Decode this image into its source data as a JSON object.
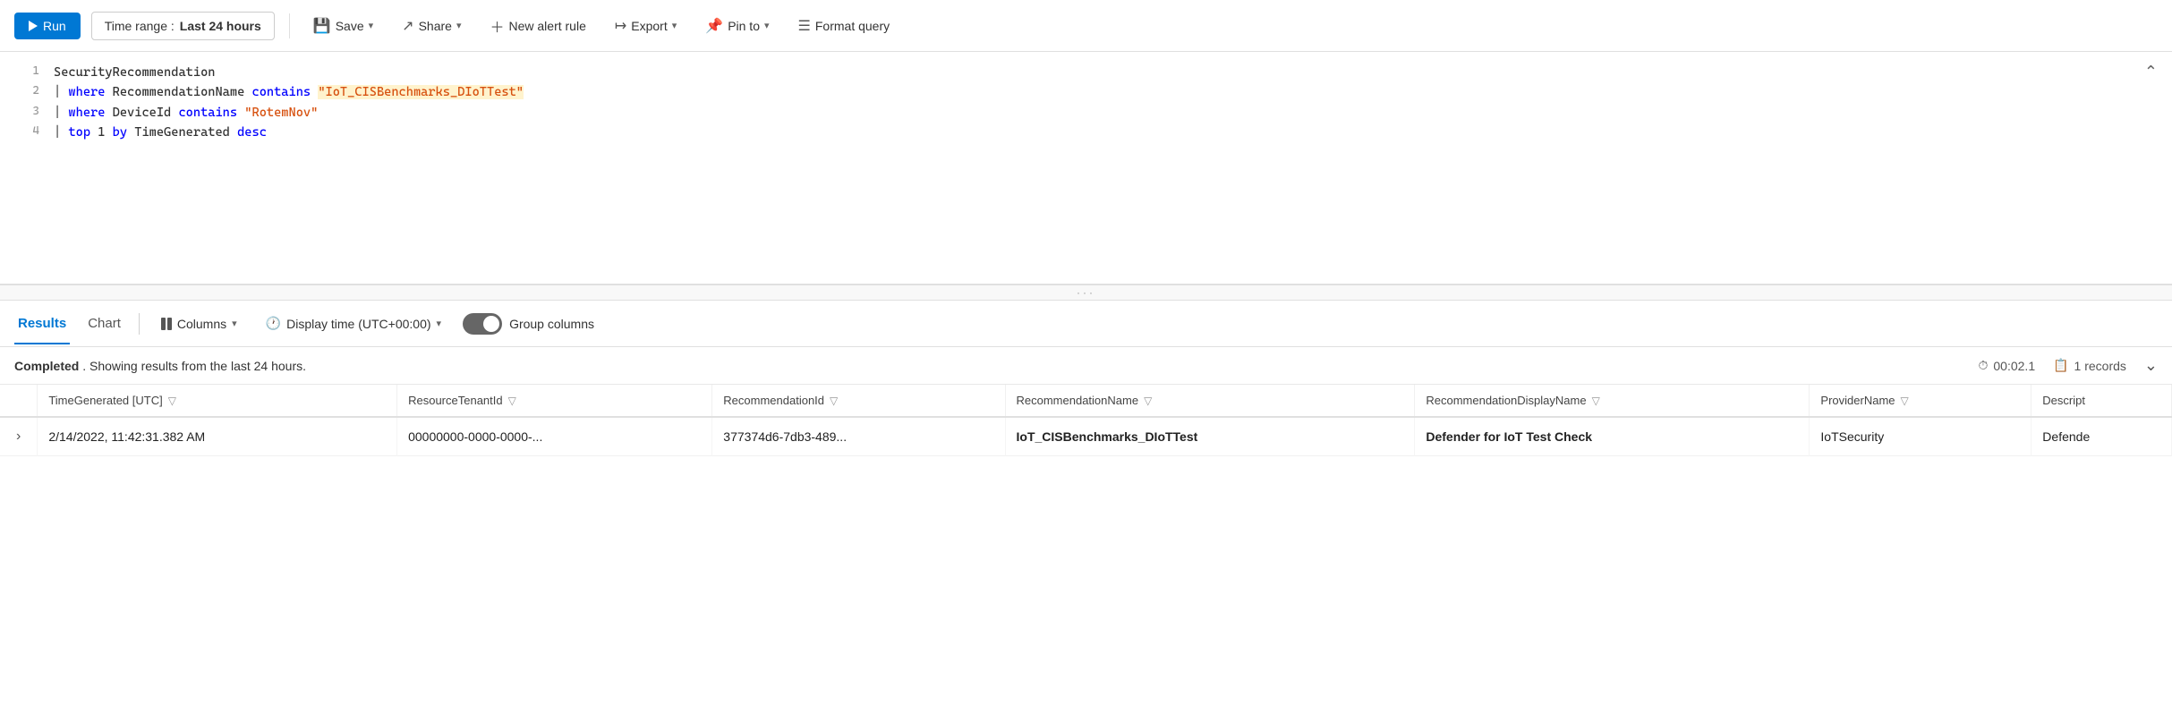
{
  "toolbar": {
    "run_label": "Run",
    "time_range_prefix": "Time range : ",
    "time_range_value": "Last 24 hours",
    "save_label": "Save",
    "share_label": "Share",
    "new_alert_label": "New alert rule",
    "export_label": "Export",
    "pin_to_label": "Pin to",
    "format_query_label": "Format query"
  },
  "editor": {
    "lines": [
      {
        "number": "1",
        "content": "SecurityRecommendation"
      },
      {
        "number": "2",
        "content": "| where RecommendationName contains \"IoT_CISBenchmarks_DIoTTest\""
      },
      {
        "number": "3",
        "content": "| where DeviceId contains \"RotemNov\""
      },
      {
        "number": "4",
        "content": "| top 1 by TimeGenerated desc"
      }
    ]
  },
  "results": {
    "tab_results": "Results",
    "tab_chart": "Chart",
    "columns_label": "Columns",
    "display_time_label": "Display time (UTC+00:00)",
    "group_columns_label": "Group columns",
    "status_text": "Completed",
    "status_desc": ". Showing results from the last 24 hours.",
    "query_time": "00:02.1",
    "record_count": "1 records",
    "columns": [
      "TimeGenerated [UTC]",
      "ResourceTenantId",
      "RecommendationId",
      "RecommendationName",
      "RecommendationDisplayName",
      "ProviderName",
      "Descript"
    ],
    "rows": [
      {
        "time": "2/14/2022, 11:42:31.382 AM",
        "resource_tenant_id": "00000000-0000-0000-...",
        "recommendation_id": "377374d6-7db3-489...",
        "recommendation_name": "IoT_CISBenchmarks_DIoTTest",
        "recommendation_display_name": "Defender for IoT Test Check",
        "provider_name": "IoTSecurity",
        "description": "Defende"
      }
    ]
  }
}
